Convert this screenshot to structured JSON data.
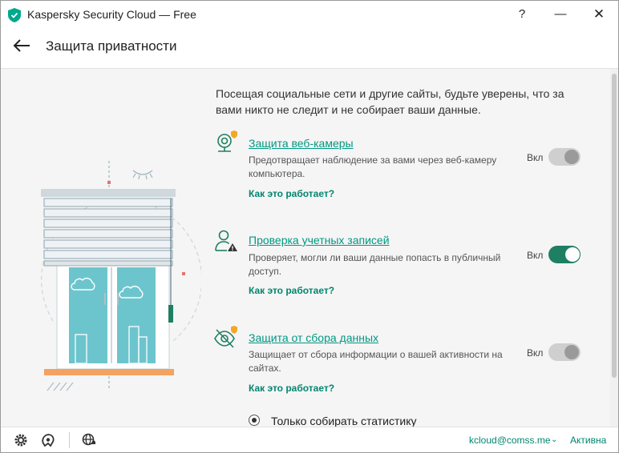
{
  "window": {
    "title": "Kaspersky Security Cloud — Free",
    "help": "?",
    "minimize": "—",
    "close": "✕"
  },
  "header": {
    "title": "Защита приватности"
  },
  "intro": "Посещая социальные сети и другие сайты, будьте уверены, что за вами никто не следит и не собирает ваши данные.",
  "features": [
    {
      "title": "Защита веб-камеры",
      "desc": "Предотвращает наблюдение за вами через веб-камеру компьютера.",
      "how": "Как это работает?",
      "toggle_label": "Вкл",
      "enabled": false,
      "icon": "webcam-icon"
    },
    {
      "title": "Проверка учетных записей",
      "desc": "Проверяет, могли ли ваши данные попасть в публичный доступ.",
      "how": "Как это работает?",
      "toggle_label": "Вкл",
      "enabled": true,
      "icon": "account-check-icon"
    },
    {
      "title": "Защита от сбора данных",
      "desc": "Защищает от сбора информации о вашей активности на сайтах.",
      "how": "Как это работает?",
      "toggle_label": "Вкл",
      "enabled": false,
      "icon": "eye-off-icon"
    }
  ],
  "option": {
    "label": "Только собирать статистику",
    "selected": true
  },
  "footer": {
    "account": "kcloud@comss.me",
    "chevron": "⌄",
    "status": "Активна"
  },
  "colors": {
    "accent": "#009882",
    "toggle_on": "#1e7f63",
    "toggle_off": "#cfcfcf",
    "warning": "#f5a623"
  }
}
